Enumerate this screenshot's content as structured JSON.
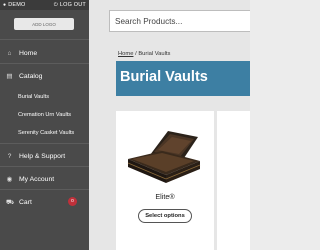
{
  "topbar": {
    "left_label": "DEMO",
    "left_icon": "user-icon",
    "right_label": "LOG OUT",
    "right_icon": "logout-icon"
  },
  "logo": {
    "text": "ADD LOGO",
    "icon": "logo-placeholder"
  },
  "nav": {
    "home": {
      "label": "Home",
      "icon": "home-icon"
    },
    "catalog": {
      "label": "Catalog",
      "icon": "book-icon"
    },
    "catalog_sub": [
      "Burial Vaults",
      "Cremation Urn Vaults",
      "Serenity Casket Vaults"
    ],
    "help": {
      "label": "Help & Support",
      "icon": "question-icon"
    },
    "account": {
      "label": "My Account",
      "icon": "user-circle-icon"
    },
    "cart": {
      "label": "Cart",
      "icon": "cart-icon",
      "count": "0"
    }
  },
  "search": {
    "placeholder": "Search Products..."
  },
  "breadcrumb": {
    "home": "Home",
    "separator": " / ",
    "current": "Burial Vaults"
  },
  "page": {
    "title": "Burial Vaults",
    "banner_color": "#3d7fa3"
  },
  "products": [
    {
      "name": "Elite®",
      "button": "Select options"
    }
  ],
  "colors": {
    "sidebar": "#4a4a4a",
    "badge": "#c0303a"
  }
}
